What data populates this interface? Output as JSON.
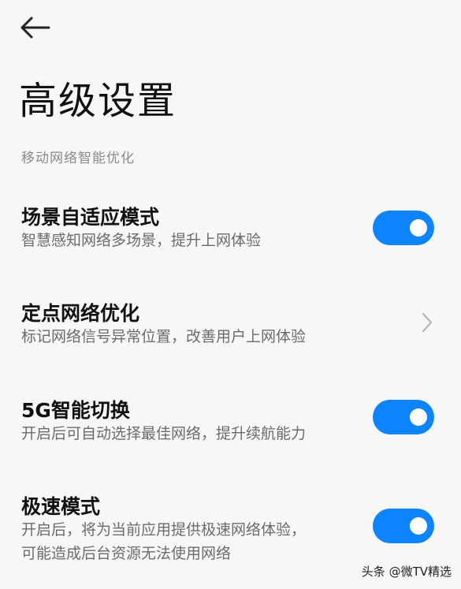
{
  "header": {
    "back_icon": "arrow-left-icon",
    "title": "高级设置"
  },
  "section": {
    "label": "移动网络智能优化"
  },
  "settings": [
    {
      "title": "场景自适应模式",
      "subtitle": "智慧感知网络多场景，提升上网体验",
      "control": "toggle",
      "enabled": true
    },
    {
      "title": "定点网络优化",
      "subtitle": "标记网络信号异常位置，改善用户上网体验",
      "control": "chevron-right-icon"
    },
    {
      "title": "5G智能切换",
      "subtitle": "开启后可自动选择最佳网络，提升续航能力",
      "control": "toggle",
      "enabled": true
    },
    {
      "title": "极速模式",
      "subtitle_line1": "开启后，将为当前应用提供极速网络体验，",
      "subtitle_line2": "可能造成后台资源无法使用网络",
      "control": "toggle",
      "enabled": true
    }
  ],
  "watermark": "头条 @微TV精选",
  "colors": {
    "accent": "#0d84ff",
    "background": "#f7f7f7",
    "title_text": "#111111",
    "secondary_text": "#6b6b6b",
    "section_text": "#8a8a8a"
  }
}
